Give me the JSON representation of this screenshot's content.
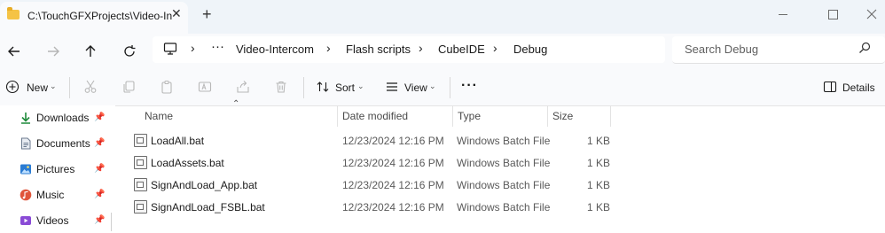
{
  "window": {
    "tab_title": "C:\\TouchGFXProjects\\Video-In",
    "close_glyph": "✕",
    "new_tab_glyph": "+"
  },
  "address": {
    "overflow": "···",
    "crumbs": [
      "Video-Intercom",
      "Flash scripts",
      "CubeIDE",
      "Debug"
    ],
    "chevron": "›"
  },
  "search": {
    "placeholder": "Search Debug"
  },
  "commands": {
    "new": "New",
    "sort": "Sort",
    "view": "View",
    "more": "···",
    "details": "Details",
    "caret": "⌄"
  },
  "nav_pane": {
    "items": [
      {
        "label": "Downloads",
        "icon": "download-icon",
        "color": "#1f8a3b"
      },
      {
        "label": "Documents",
        "icon": "documents-icon",
        "color": "#6b7a8f"
      },
      {
        "label": "Pictures",
        "icon": "pictures-icon",
        "color": "#2b7cd3"
      },
      {
        "label": "Music",
        "icon": "music-icon",
        "color": "#e0553b"
      },
      {
        "label": "Videos",
        "icon": "videos-icon",
        "color": "#8a4bd6"
      }
    ],
    "pin_glyph": "📌"
  },
  "file_list": {
    "columns": {
      "name": "Name",
      "date": "Date modified",
      "type": "Type",
      "size": "Size"
    },
    "sort_indicator": "⌃",
    "rows": [
      {
        "name": "LoadAll.bat",
        "date": "12/23/2024 12:16 PM",
        "type": "Windows Batch File",
        "size": "1 KB"
      },
      {
        "name": "LoadAssets.bat",
        "date": "12/23/2024 12:16 PM",
        "type": "Windows Batch File",
        "size": "1 KB"
      },
      {
        "name": "SignAndLoad_App.bat",
        "date": "12/23/2024 12:16 PM",
        "type": "Windows Batch File",
        "size": "1 KB"
      },
      {
        "name": "SignAndLoad_FSBL.bat",
        "date": "12/23/2024 12:16 PM",
        "type": "Windows Batch File",
        "size": "1 KB"
      }
    ]
  },
  "colors": {
    "titlebar_bg": "#eff4f9",
    "toolbar_bg": "#f9fafc",
    "folder_yellow": "#f5c345"
  }
}
